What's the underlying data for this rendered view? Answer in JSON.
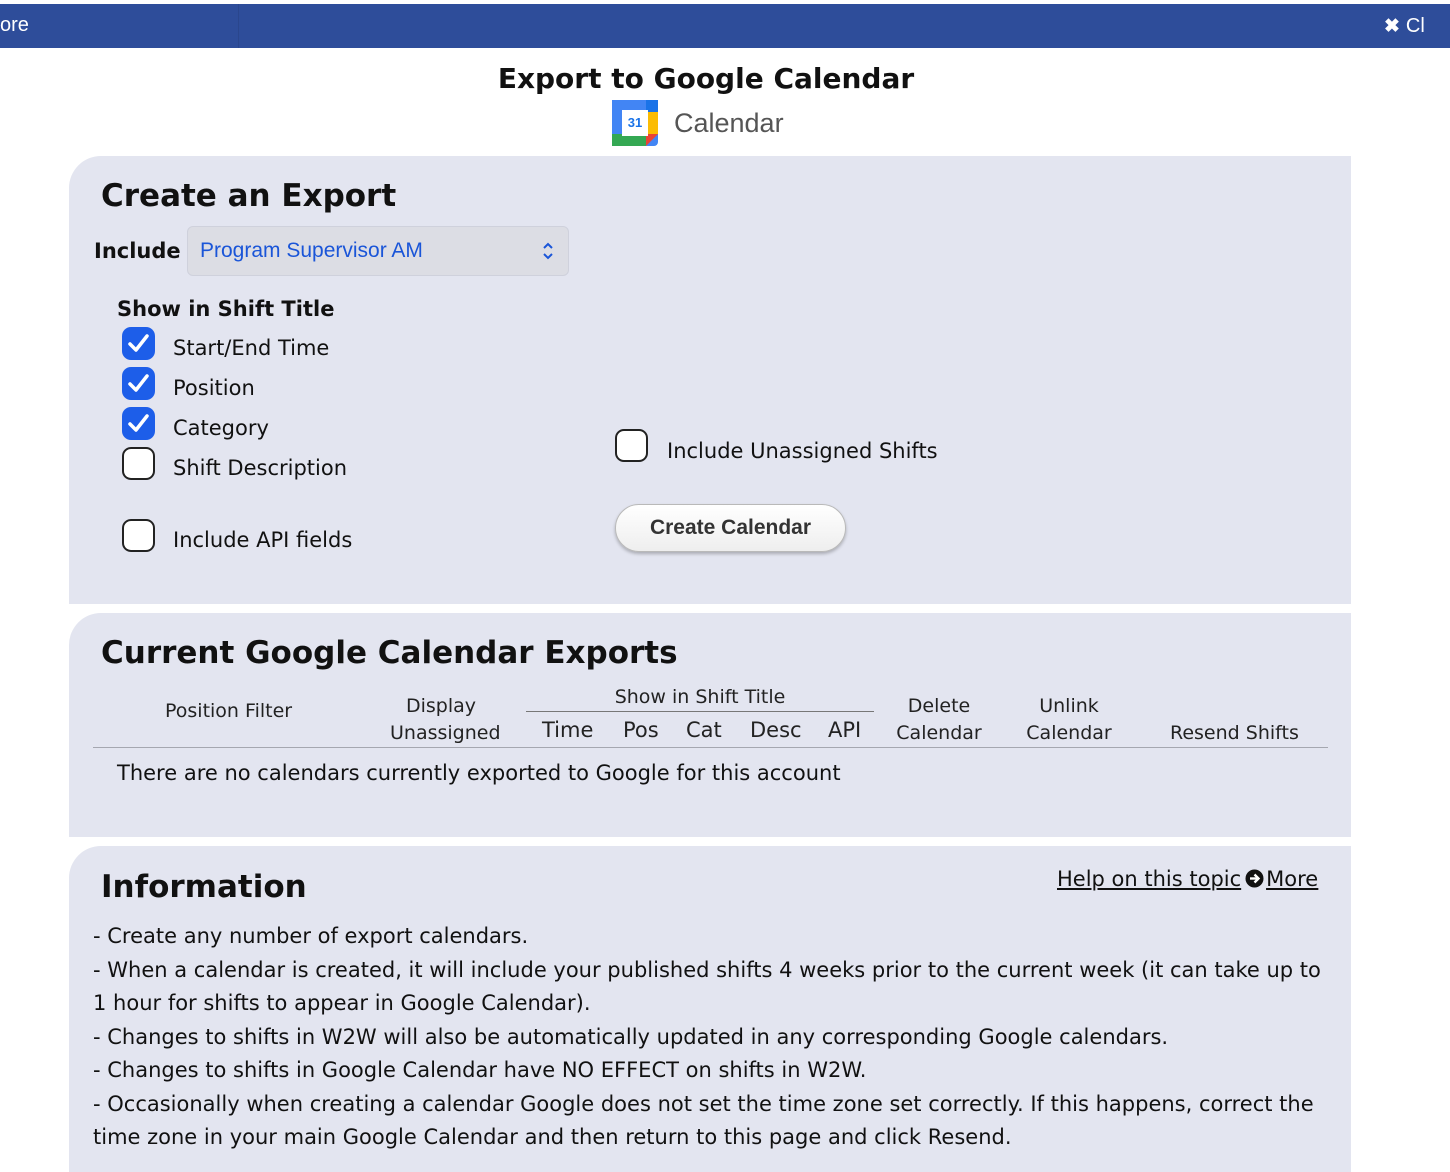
{
  "topbar": {
    "left_text": "ore",
    "close_text": "Cl",
    "color": "#2e4d9a"
  },
  "header": {
    "title": "Export to Google Calendar",
    "logo_number": "31",
    "logo_text": "Calendar"
  },
  "create": {
    "heading": "Create an Export",
    "include_label": "Include",
    "include_value": "Program Supervisor AM",
    "show_title_heading": "Show in Shift Title",
    "options": [
      {
        "label": "Start/End Time",
        "checked": true
      },
      {
        "label": "Position",
        "checked": true
      },
      {
        "label": "Category",
        "checked": true
      },
      {
        "label": "Shift Description",
        "checked": false
      }
    ],
    "api_label": "Include API fields",
    "api_checked": false,
    "unassigned_label": "Include Unassigned Shifts",
    "unassigned_checked": false,
    "create_button": "Create Calendar"
  },
  "exports": {
    "heading": "Current Google Calendar Exports",
    "columns": {
      "position_filter": "Position Filter",
      "display": "Display",
      "unassigned": "Unassigned",
      "show_group": "Show in Shift Title",
      "time": "Time",
      "pos": "Pos",
      "cat": "Cat",
      "desc": "Desc",
      "api": "API",
      "delete1": "Delete",
      "delete2": "Calendar",
      "unlink1": "Unlink",
      "unlink2": "Calendar",
      "resend": "Resend Shifts"
    },
    "empty_message": "There are no calendars currently exported to Google for this account"
  },
  "information": {
    "heading": "Information",
    "help_link": "Help on this topic",
    "more_link": "More",
    "lines": [
      "- Create any number of export calendars.",
      "- When a calendar is created, it will include your published shifts 4 weeks prior to the current week (it can take up to 1 hour for shifts to appear in Google Calendar).",
      "- Changes to shifts in W2W will also be automatically updated in any corresponding Google calendars.",
      "- Changes to shifts in Google Calendar have NO EFFECT on shifts in W2W.",
      "- Occasionally when creating a calendar Google does not set the time zone set correctly. If this happens, correct the time zone in your main Google Calendar and then return to this page and click Resend."
    ]
  },
  "colors": {
    "panel": "#e3e5f0",
    "accent": "#1d5ee9",
    "select_text": "#1a55d8"
  }
}
